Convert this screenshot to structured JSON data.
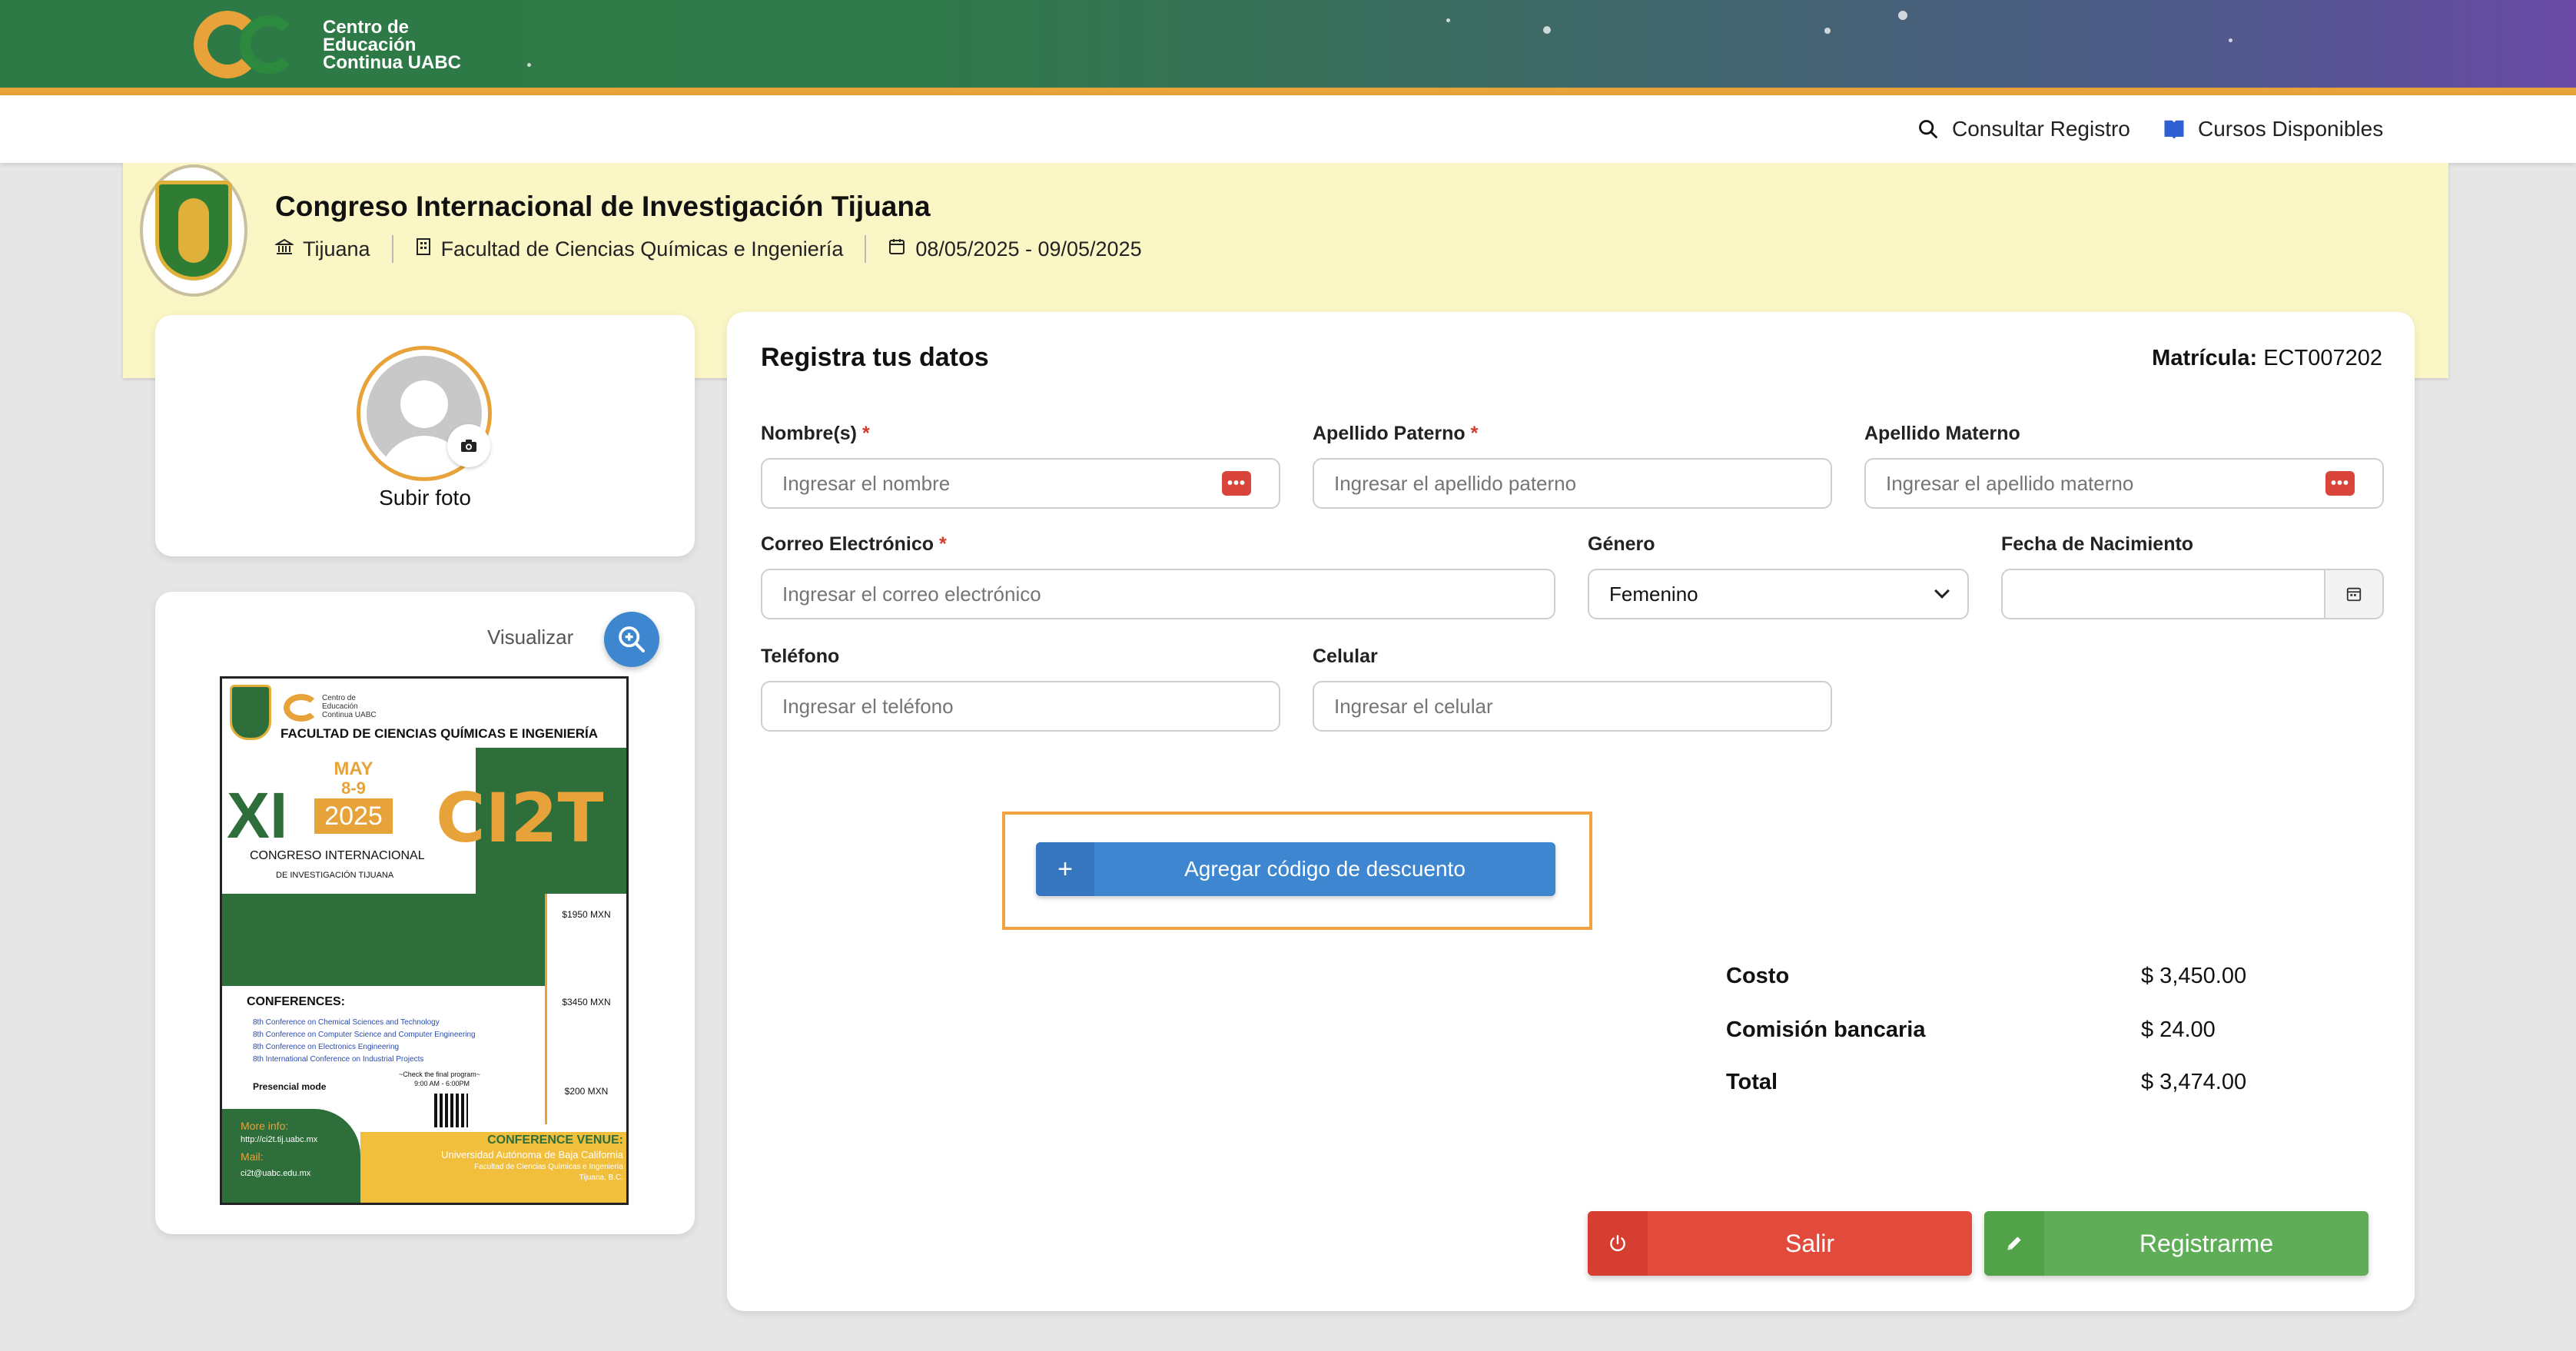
{
  "brand": {
    "logo_lines": [
      "Centro de",
      "Educación",
      "Continua UABC"
    ],
    "colors": {
      "header_green": "#2e7a45",
      "header_purple": "#6a4aa6",
      "accent_orange": "#e8a23a",
      "banner_yellow": "#fbf6c6"
    }
  },
  "nav": {
    "consultar_label": "Consultar Registro",
    "consultar_icon": "search-icon",
    "cursos_label": "Cursos Disponibles",
    "cursos_icon": "book-icon"
  },
  "event": {
    "title": "Congreso Internacional de Investigación Tijuana",
    "city": "Tijuana",
    "faculty": "Facultad de Ciencias Químicas e Ingeniería",
    "dates": "08/05/2025 - 09/05/2025"
  },
  "photo": {
    "upload_label": "Subir foto"
  },
  "poster": {
    "view_label": "Visualizar",
    "header": "FACULTAD DE CIENCIAS QUÍMICAS E INGENIERÍA",
    "month": "MAY",
    "days": "8-9",
    "year": "2025",
    "roman": "XI",
    "acronym": "CI2T",
    "congress_line1": "CONGRESO INTERNACIONAL",
    "congress_line2": "DE INVESTIGACIÓN TIJUANA",
    "conferences_title": "CONFERENCES:",
    "conferences": [
      "8th Conference on Chemical Sciences and Technology",
      "8th Conference on Computer Science and Computer Engineering",
      "8th Conference on Electronics Engineering",
      "8th International Conference on Industrial Projects"
    ],
    "mode": "Presencial mode",
    "program_note": "~Check the final program~",
    "hours": "9:00 AM - 6:00PM",
    "prices": [
      "$1950 MXN",
      "$3450 MXN",
      "$200 MXN"
    ],
    "more_info": "More info:",
    "url": "http://ci2t.tij.uabc.mx",
    "mail_label": "Mail:",
    "mail": "ci2t@uabc.edu.mx",
    "venue_title": "CONFERENCE VENUE:",
    "venue_line1": "Universidad Autónoma de Baja California",
    "venue_line2": "Facultad de Ciencias Químicas e Ingeniería",
    "venue_line3": "Tijuana, B.C."
  },
  "form": {
    "title": "Registra tus datos",
    "matricula_label": "Matrícula:",
    "matricula_value": "ECT007202",
    "nombre": {
      "label": "Nombre(s)",
      "placeholder": "Ingresar el nombre"
    },
    "apellido_paterno": {
      "label": "Apellido Paterno",
      "placeholder": "Ingresar el apellido paterno"
    },
    "apellido_materno": {
      "label": "Apellido Materno",
      "placeholder": "Ingresar el apellido materno"
    },
    "correo": {
      "label": "Correo Electrónico",
      "placeholder": "Ingresar el correo electrónico"
    },
    "genero": {
      "label": "Género",
      "value": "Femenino"
    },
    "fecha": {
      "label": "Fecha de Nacimiento",
      "value": ""
    },
    "telefono": {
      "label": "Teléfono",
      "placeholder": "Ingresar el teléfono"
    },
    "celular": {
      "label": "Celular",
      "placeholder": "Ingresar el celular"
    },
    "required_mark": "*",
    "keyboard_badge": "•••"
  },
  "discount": {
    "plus": "+",
    "label": "Agregar código de descuento"
  },
  "summary": [
    {
      "key": "Costo",
      "value": "$ 3,450.00"
    },
    {
      "key": "Comisión bancaria",
      "value": "$ 24.00"
    },
    {
      "key": "Total",
      "value": "$ 3,474.00"
    }
  ],
  "actions": {
    "exit_label": "Salir",
    "exit_icon": "power-icon",
    "exit_color": "#e24a3b",
    "register_label": "Registrarme",
    "register_icon": "pencil-icon",
    "register_color": "#5fae57"
  }
}
